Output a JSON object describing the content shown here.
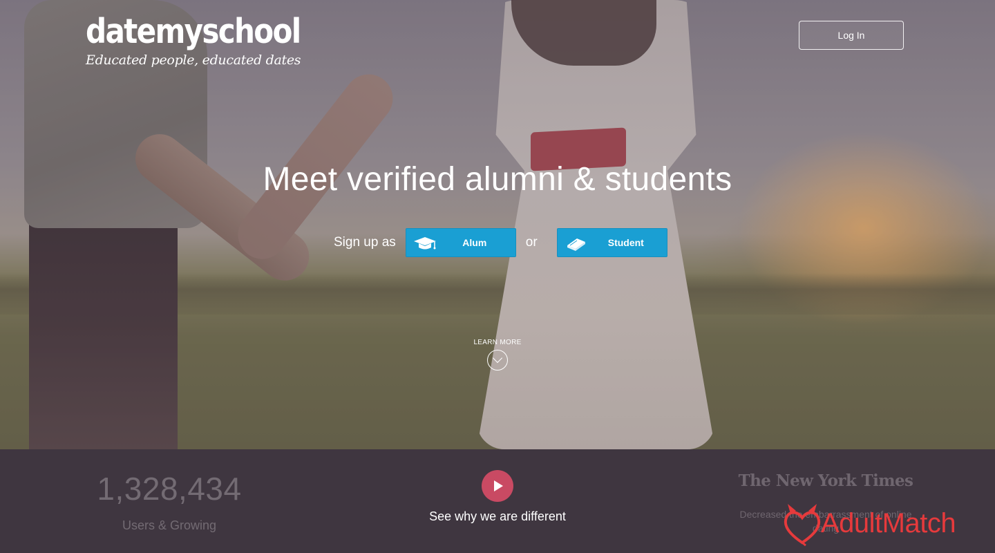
{
  "brand": {
    "name": "datemyschool",
    "tagline": "Educated people, educated dates"
  },
  "header": {
    "login_label": "Log In"
  },
  "hero": {
    "headline": "Meet verified alumni & students",
    "signup_label": "Sign up as",
    "separator": "or",
    "alum_label": "Alum",
    "alum_icon": "graduation-cap-icon",
    "student_label": "Student",
    "student_icon": "book-icon",
    "learn_more_label": "LEARN MORE",
    "learn_more_icon": "chevron-down-circle-icon"
  },
  "stats": {
    "users_count": "1,328,434",
    "users_caption": "Users & Growing"
  },
  "video": {
    "icon": "play-icon",
    "caption": "See why we are different"
  },
  "press": {
    "logo_text": "The New York Times",
    "quote": "Decreased the embarrassment of online dating"
  },
  "watermark": {
    "text": "AdultMatch",
    "icon": "devil-heart-icon"
  },
  "colors": {
    "button_blue": "#1a9fd3",
    "play_red": "#c94a63",
    "band_bg": "#3f3640",
    "watermark_red": "#e63a3c"
  }
}
